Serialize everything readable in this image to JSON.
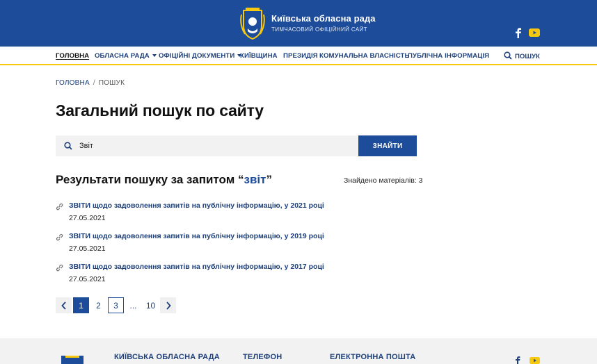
{
  "header": {
    "title": "Київська обласна рада",
    "subtitle": "ТИМЧАСОВИЙ ОФІЦІЙНИЙ САЙТ"
  },
  "nav": {
    "items": [
      {
        "label": "ГОЛОВНА"
      },
      {
        "label": "ОБЛАСНА РАДА"
      },
      {
        "label": "ОФІЦІЙНІ ДОКУМЕНТИ"
      },
      {
        "label": "КИЇВЩИНА"
      },
      {
        "label": "ПРЕЗИДІЯ"
      },
      {
        "label": "КОМУНАЛЬНА ВЛАСНІСТЬ"
      },
      {
        "label": "ПУБЛІЧНА ІНФОРМАЦІЯ"
      }
    ],
    "search_label": "ПОШУК"
  },
  "breadcrumb": {
    "home": "ГОЛОВНА",
    "separator": "/",
    "current": "ПОШУК"
  },
  "page_title": "Загальний пошук по сайту",
  "search": {
    "value": "Звіт",
    "button": "ЗНАЙТИ"
  },
  "results": {
    "heading_prefix": "Результати пошуку за запитом ",
    "quote_open": "“",
    "query": "звіт",
    "quote_close": "”",
    "found": "Знайдено матеріалів: 3",
    "items": [
      {
        "title": "ЗВІТИ щодо задоволення запитів на публічну інформацію, у 2021 році",
        "date": "27.05.2021"
      },
      {
        "title": "ЗВІТИ щодо задоволення запитів на публічну інформацію, у 2019 році",
        "date": "27.05.2021"
      },
      {
        "title": "ЗВІТИ щодо задоволення запитів на публічну інформацію, у 2017 році",
        "date": "27.05.2021"
      }
    ]
  },
  "pagination": {
    "prev": "‹",
    "pages": [
      "1",
      "2",
      "3",
      "...",
      "10"
    ],
    "next": "›"
  },
  "footer": {
    "org": "КИЇВСЬКА ОБЛАСНА РАДА",
    "phone_label": "ТЕЛЕФОН",
    "email_label": "ЕЛЕКТРОННА ПОШТА"
  },
  "icons": {
    "brand_blue": "#1d4c9b",
    "accent_yellow": "#f6c90e",
    "social": [
      "facebook-icon",
      "youtube-icon"
    ]
  }
}
